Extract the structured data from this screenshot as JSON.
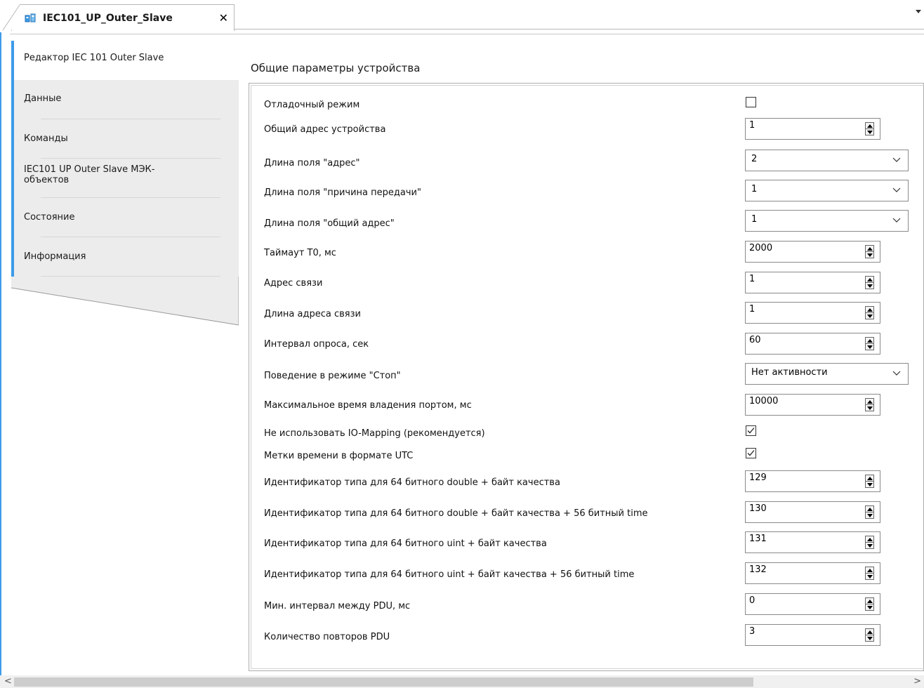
{
  "document_tab": {
    "title": "IEC101_UP_Outer_Slave",
    "close_glyph": "✕",
    "icon": "device-icon"
  },
  "sidebar": {
    "items": [
      {
        "label": "Редактор IEC 101 Outer Slave",
        "active": true
      },
      {
        "label": "Данные",
        "active": false
      },
      {
        "label": "Команды",
        "active": false
      },
      {
        "label": "IEC101 UP Outer Slave МЭК-объектов",
        "active": false
      },
      {
        "label": "Состояние",
        "active": false
      },
      {
        "label": "Информация",
        "active": false
      }
    ]
  },
  "main": {
    "section_title": "Общие параметры устройства",
    "params": [
      {
        "label": "Отладочный режим",
        "type": "checkbox",
        "checked": false
      },
      {
        "label": "Общий адрес устройства",
        "type": "spin",
        "value": "1"
      },
      {
        "label": "Длина поля \"адрес\"",
        "type": "combo",
        "value": "2"
      },
      {
        "label": "Длина поля \"причина передачи\"",
        "type": "combo",
        "value": "1"
      },
      {
        "label": "Длина поля \"общий адрес\"",
        "type": "combo",
        "value": "1"
      },
      {
        "label": "Таймаут T0, мс",
        "type": "spin",
        "value": "2000"
      },
      {
        "label": "Адрес связи",
        "type": "spin",
        "value": "1"
      },
      {
        "label": "Длина адреса связи",
        "type": "spin",
        "value": "1"
      },
      {
        "label": "Интервал опроса, сек",
        "type": "spin",
        "value": "60"
      },
      {
        "label": "Поведение в режиме \"Стоп\"",
        "type": "combo",
        "value": "Нет активности"
      },
      {
        "label": "Максимальное время владения портом, мс",
        "type": "spin",
        "value": "10000"
      },
      {
        "label": "Не использовать IO-Mapping (рекомендуется)",
        "type": "checkbox",
        "checked": true
      },
      {
        "label": "Метки времени в формате UTC",
        "type": "checkbox",
        "checked": true
      },
      {
        "label": "Идентификатор типа для 64 битного double + байт качества",
        "type": "spin",
        "value": "129"
      },
      {
        "label": "Идентификатор типа для 64 битного double + байт качества + 56 битный time",
        "type": "spin",
        "value": "130"
      },
      {
        "label": "Идентификатор типа для 64 битного uint + байт качества",
        "type": "spin",
        "value": "131"
      },
      {
        "label": "Идентификатор типа для 64 битного uint + байт качества + 56 битный time",
        "type": "spin",
        "value": "132"
      },
      {
        "label": "Мин. интервал между PDU, мс",
        "type": "spin",
        "value": "0"
      },
      {
        "label": "Количество повторов PDU",
        "type": "spin",
        "value": "3"
      }
    ]
  },
  "scrollbar": {
    "left_arrow": "<",
    "right_arrow": ">"
  },
  "colors": {
    "accent": "#3d9be9",
    "sidebar_inactive": "#ececec",
    "panel_border": "#adadad"
  }
}
